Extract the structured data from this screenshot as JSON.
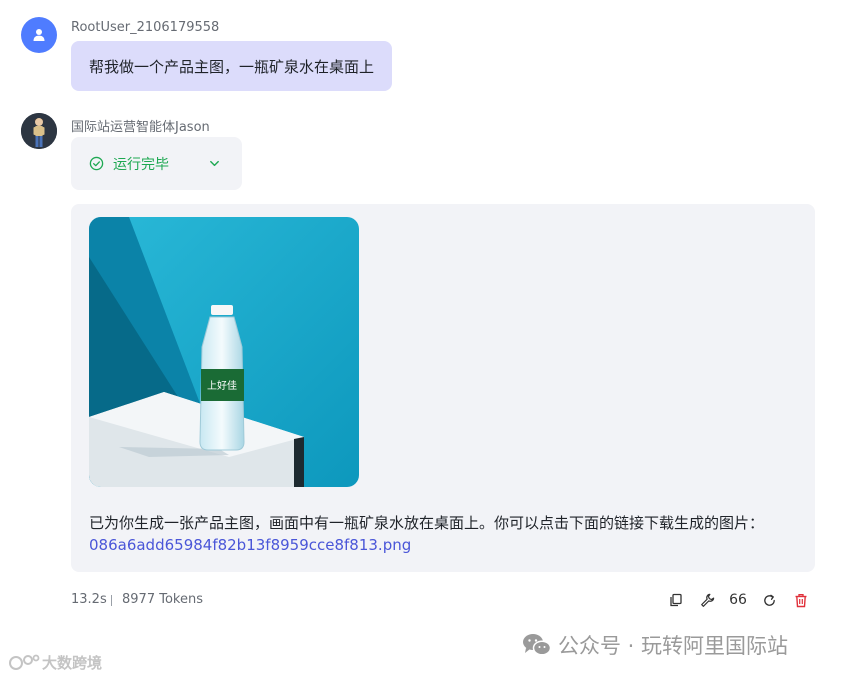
{
  "user_message": {
    "username": "RootUser_2106179558",
    "text": "帮我做一个产品主图，一瓶矿泉水在桌面上"
  },
  "agent_message": {
    "agent_name": "国际站运营智能体Jason",
    "status_label": "运行完毕",
    "reply_text": "已为你生成一张产品主图，画面中有一瓶矿泉水放在桌面上。你可以点击下面的链接下载生成的图片：",
    "link_text": "086a6add65984f82b13f8959cce8f813.png",
    "bottle_label": "上好佳"
  },
  "footer": {
    "time": "13.2s",
    "tokens": "8977 Tokens",
    "quote_count": "66"
  },
  "watermark": {
    "right_text": "公众号 · 玩转阿里国际站",
    "left_text": "大数跨境"
  },
  "colors": {
    "user_avatar": "#4f7cff",
    "user_bubble": "#dcdcfb",
    "status_green": "#1ea852",
    "link": "#4a56d8",
    "delete_red": "#e0303a",
    "card_bg": "#f2f3f7"
  },
  "icons": {
    "user_avatar": "user-icon",
    "status": "check-circle-icon",
    "expand": "chevron-down-icon",
    "copy": "copy-icon",
    "tool": "wrench-icon",
    "quote": "quote-icon",
    "regenerate": "refresh-icon",
    "delete": "trash-icon",
    "wechat": "wechat-icon"
  }
}
